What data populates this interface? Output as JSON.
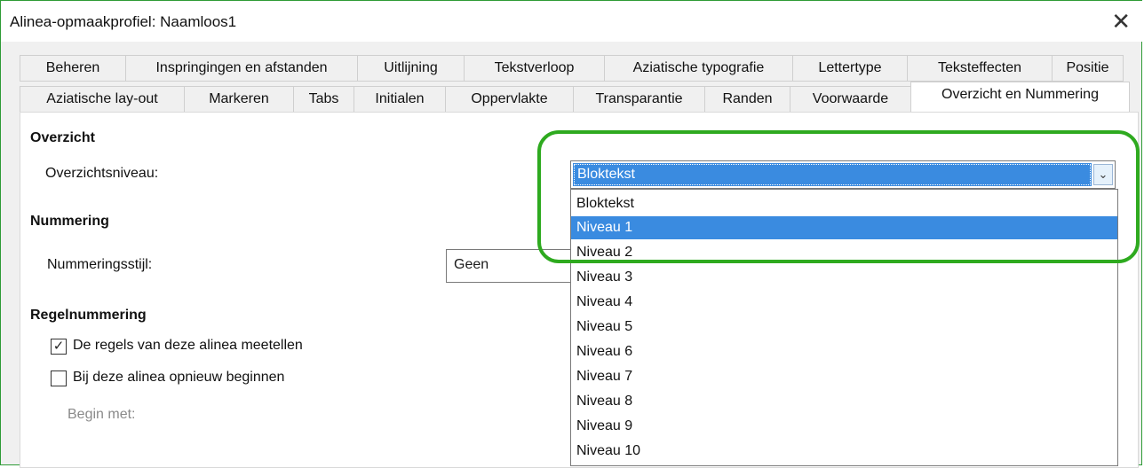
{
  "window": {
    "title": "Alinea-opmaakprofiel: Naamloos1",
    "close_glyph": "✕"
  },
  "tabs_row1": [
    "Beheren",
    "Inspringingen en afstanden",
    "Uitlijning",
    "Tekstverloop",
    "Aziatische typografie",
    "Lettertype",
    "Teksteffecten",
    "Positie"
  ],
  "tabs_row2": [
    "Aziatische lay-out",
    "Markeren",
    "Tabs",
    "Initialen",
    "Oppervlakte",
    "Transparantie",
    "Randen",
    "Voorwaarde",
    "Overzicht en Nummering"
  ],
  "active_tab": "Overzicht en Nummering",
  "outline": {
    "section_title": "Overzicht",
    "level_label": "Overzichtsniveau:",
    "selected": "Bloktekst",
    "options": [
      "Bloktekst",
      "Niveau 1",
      "Niveau 2",
      "Niveau 3",
      "Niveau 4",
      "Niveau 5",
      "Niveau 6",
      "Niveau 7",
      "Niveau 8",
      "Niveau 9",
      "Niveau 10"
    ],
    "highlighted": "Niveau 1"
  },
  "numbering": {
    "section_title": "Nummering",
    "style_label": "Nummeringsstijl:",
    "style_value": "Geen"
  },
  "line_numbering": {
    "section_title": "Regelnummering",
    "count_label": "De regels van deze alinea meetellen",
    "count_checked": true,
    "restart_label": "Bij deze alinea opnieuw beginnen",
    "restart_checked": false,
    "start_label": "Begin met:"
  },
  "colors": {
    "accent": "#3a8be0",
    "highlight_ring": "#2eaa1f"
  }
}
